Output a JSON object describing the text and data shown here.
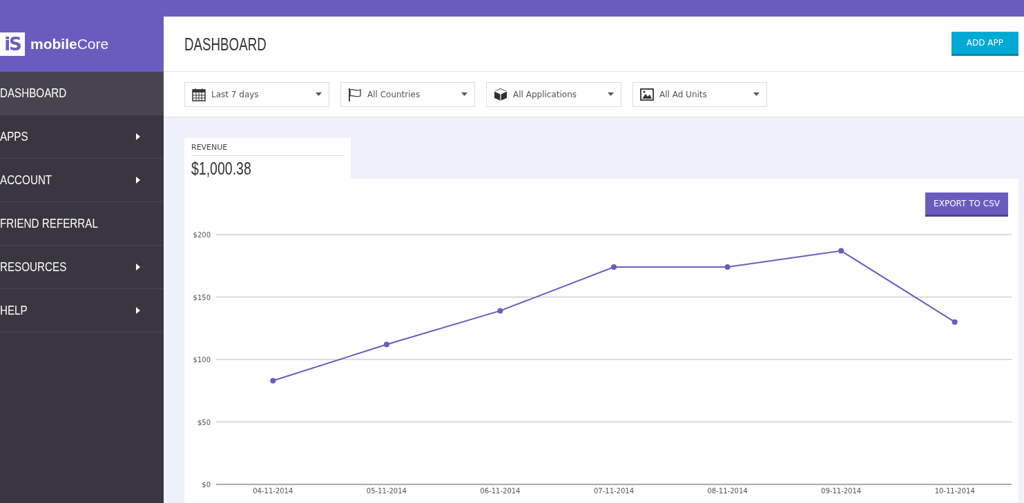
{
  "brand": {
    "logo": "iS",
    "name_bold": "mobile",
    "name_rest": "Core"
  },
  "sidebar": {
    "items": [
      {
        "label": "DASHBOARD",
        "selected": true,
        "submenu": false
      },
      {
        "label": "APPS",
        "selected": false,
        "submenu": true
      },
      {
        "label": "ACCOUNT",
        "selected": false,
        "submenu": true
      },
      {
        "label": "FRIEND REFERRAL",
        "selected": false,
        "submenu": false
      },
      {
        "label": "RESOURCES",
        "selected": false,
        "submenu": true
      },
      {
        "label": "HELP",
        "selected": false,
        "submenu": true
      }
    ]
  },
  "header": {
    "title": "DASHBOARD",
    "button": "ADD APP"
  },
  "filters": [
    {
      "kind": "date",
      "value": "Last 7 days"
    },
    {
      "kind": "country",
      "value": "All Countries"
    },
    {
      "kind": "application",
      "value": "All Applications"
    },
    {
      "kind": "ad_unit",
      "value": "All Ad Units"
    }
  ],
  "revenue": {
    "label": "REVENUE",
    "value": "$1,000.38",
    "export_button": "EXPORT TO CSV",
    "chart_data": {
      "type": "line",
      "categories": [
        "04-11-2014",
        "05-11-2014",
        "06-11-2014",
        "07-11-2014",
        "08-11-2014",
        "09-11-2014",
        "10-11-2014"
      ],
      "series": [
        {
          "color": "#6a5cbf",
          "marker": true,
          "values": [
            83,
            112,
            139,
            174,
            174,
            187,
            130
          ]
        }
      ],
      "grid": true,
      "ylim": [
        0,
        200
      ],
      "yticks": [
        {
          "value": 0,
          "label": "$0"
        },
        {
          "value": 50,
          "label": "$50"
        },
        {
          "value": 100,
          "label": "$100"
        },
        {
          "value": 150,
          "label": "$150"
        },
        {
          "value": 200,
          "label": "$200"
        }
      ]
    }
  }
}
